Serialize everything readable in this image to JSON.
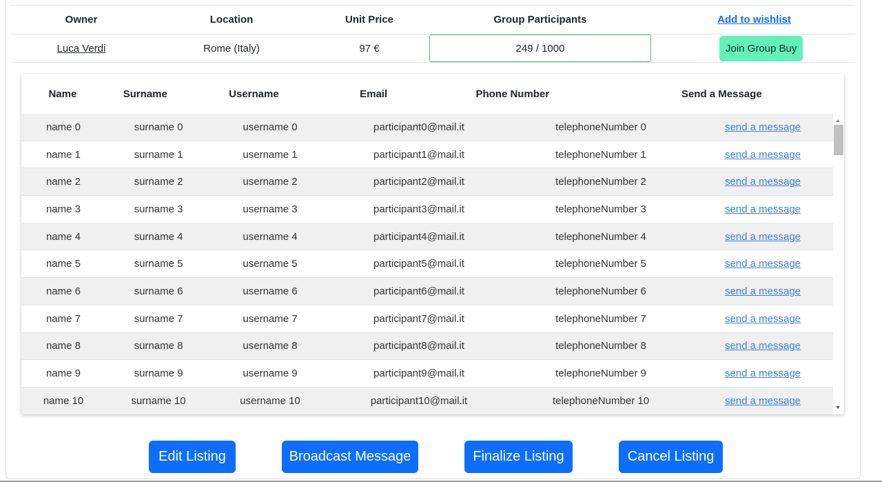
{
  "summary": {
    "headers": {
      "owner": "Owner",
      "location": "Location",
      "unit_price": "Unit Price",
      "group_participants": "Group Participants",
      "wishlist": "Add to wishlist"
    },
    "row": {
      "owner": "Luca Verdi",
      "location": "Rome (Italy)",
      "unit_price": "97 €",
      "participants": "249 / 1000",
      "join_label": "Join Group Buy"
    }
  },
  "participants_table": {
    "headers": {
      "name": "Name",
      "surname": "Surname",
      "username": "Username",
      "email": "Email",
      "phone": "Phone Number",
      "message": "Send a Message"
    },
    "rows": [
      {
        "name": "name 0",
        "surname": "surname 0",
        "username": "username 0",
        "email": "participant0@mail.it",
        "phone": "telephoneNumber 0",
        "message": "send a message"
      },
      {
        "name": "name 1",
        "surname": "surname 1",
        "username": "username 1",
        "email": "participant1@mail.it",
        "phone": "telephoneNumber 1",
        "message": "send a message"
      },
      {
        "name": "name 2",
        "surname": "surname 2",
        "username": "username 2",
        "email": "participant2@mail.it",
        "phone": "telephoneNumber 2",
        "message": "send a message"
      },
      {
        "name": "name 3",
        "surname": "surname 3",
        "username": "username 3",
        "email": "participant3@mail.it",
        "phone": "telephoneNumber 3",
        "message": "send a message"
      },
      {
        "name": "name 4",
        "surname": "surname 4",
        "username": "username 4",
        "email": "participant4@mail.it",
        "phone": "telephoneNumber 4",
        "message": "send a message"
      },
      {
        "name": "name 5",
        "surname": "surname 5",
        "username": "username 5",
        "email": "participant5@mail.it",
        "phone": "telephoneNumber 5",
        "message": "send a message"
      },
      {
        "name": "name 6",
        "surname": "surname 6",
        "username": "username 6",
        "email": "participant6@mail.it",
        "phone": "telephoneNumber 6",
        "message": "send a message"
      },
      {
        "name": "name 7",
        "surname": "surname 7",
        "username": "username 7",
        "email": "participant7@mail.it",
        "phone": "telephoneNumber 7",
        "message": "send a message"
      },
      {
        "name": "name 8",
        "surname": "surname 8",
        "username": "username 8",
        "email": "participant8@mail.it",
        "phone": "telephoneNumber 8",
        "message": "send a message"
      },
      {
        "name": "name 9",
        "surname": "surname 9",
        "username": "username 9",
        "email": "participant9@mail.it",
        "phone": "telephoneNumber 9",
        "message": "send a message"
      },
      {
        "name": "name 10",
        "surname": "surname 10",
        "username": "username 10",
        "email": "participant10@mail.it",
        "phone": "telephoneNumber 10",
        "message": "send a message"
      }
    ]
  },
  "actions": {
    "edit": "Edit Listing",
    "broadcast": "Broadcast Message",
    "finalize": "Finalize Listing",
    "cancel": "Cancel Listing"
  },
  "colors": {
    "primary": "#0d6efd",
    "join": "#62f0bd",
    "participants_border": "#45c16a",
    "link": "#3b82e0"
  }
}
